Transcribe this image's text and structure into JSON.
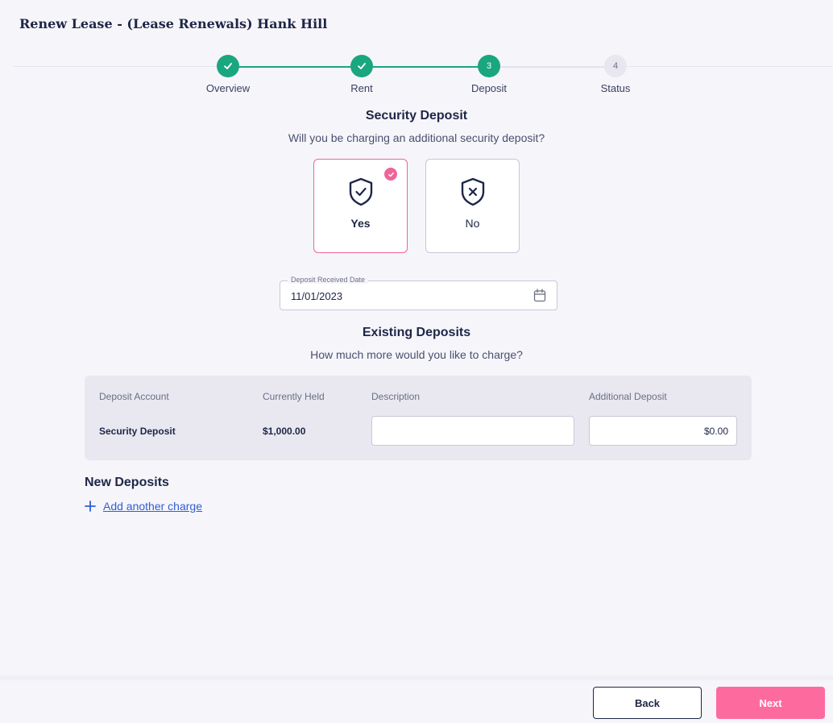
{
  "page": {
    "title": "Renew Lease - (Lease Renewals) Hank Hill"
  },
  "stepper": {
    "steps": [
      {
        "label": "Overview",
        "status": "complete",
        "number": "1"
      },
      {
        "label": "Rent",
        "status": "complete",
        "number": "2"
      },
      {
        "label": "Deposit",
        "status": "current",
        "number": "3"
      },
      {
        "label": "Status",
        "status": "pending",
        "number": "4"
      }
    ]
  },
  "security_deposit": {
    "title": "Security Deposit",
    "question": "Will you be charging an additional security deposit?",
    "options": [
      {
        "label": "Yes",
        "icon": "shield-check-icon",
        "selected": true
      },
      {
        "label": "No",
        "icon": "shield-x-icon",
        "selected": false
      }
    ]
  },
  "deposit_date": {
    "label": "Deposit Received Date",
    "value": "11/01/2023"
  },
  "existing_deposits": {
    "title": "Existing Deposits",
    "question": "How much more would you like to charge?",
    "columns": [
      "Deposit Account",
      "Currently Held",
      "Description",
      "Additional Deposit"
    ],
    "rows": [
      {
        "account": "Security Deposit",
        "held": "$1,000.00",
        "description": "",
        "additional": "$0.00"
      }
    ]
  },
  "new_deposits": {
    "title": "New Deposits",
    "add_label": "Add another charge"
  },
  "footer": {
    "back_label": "Back",
    "next_label": "Next"
  },
  "colors": {
    "accent_green": "#1aa67f",
    "accent_pink": "#fd6b9e",
    "link_blue": "#2f5fd1",
    "navy": "#1e2647"
  }
}
